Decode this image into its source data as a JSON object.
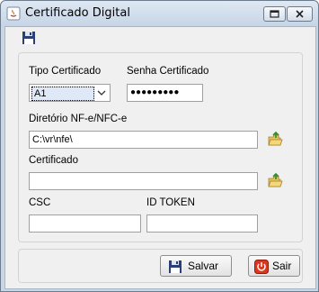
{
  "window": {
    "title": "Certificado Digital"
  },
  "form": {
    "tipo_label": "Tipo Certificado",
    "tipo_value": "A1",
    "senha_label": "Senha Certificado",
    "senha_value": "●●●●●●●●●",
    "diretorio_label": "Diretório NF-e/NFC-e",
    "diretorio_value": "C:\\vr\\nfe\\",
    "certificado_label": "Certificado",
    "certificado_value": "",
    "csc_label": "CSC",
    "csc_value": "",
    "idtoken_label": "ID TOKEN",
    "idtoken_value": ""
  },
  "buttons": {
    "salvar": "Salvar",
    "sair": "Sair"
  },
  "colors": {
    "accent": "#3a7bd5",
    "exit_red": "#d9381e"
  }
}
